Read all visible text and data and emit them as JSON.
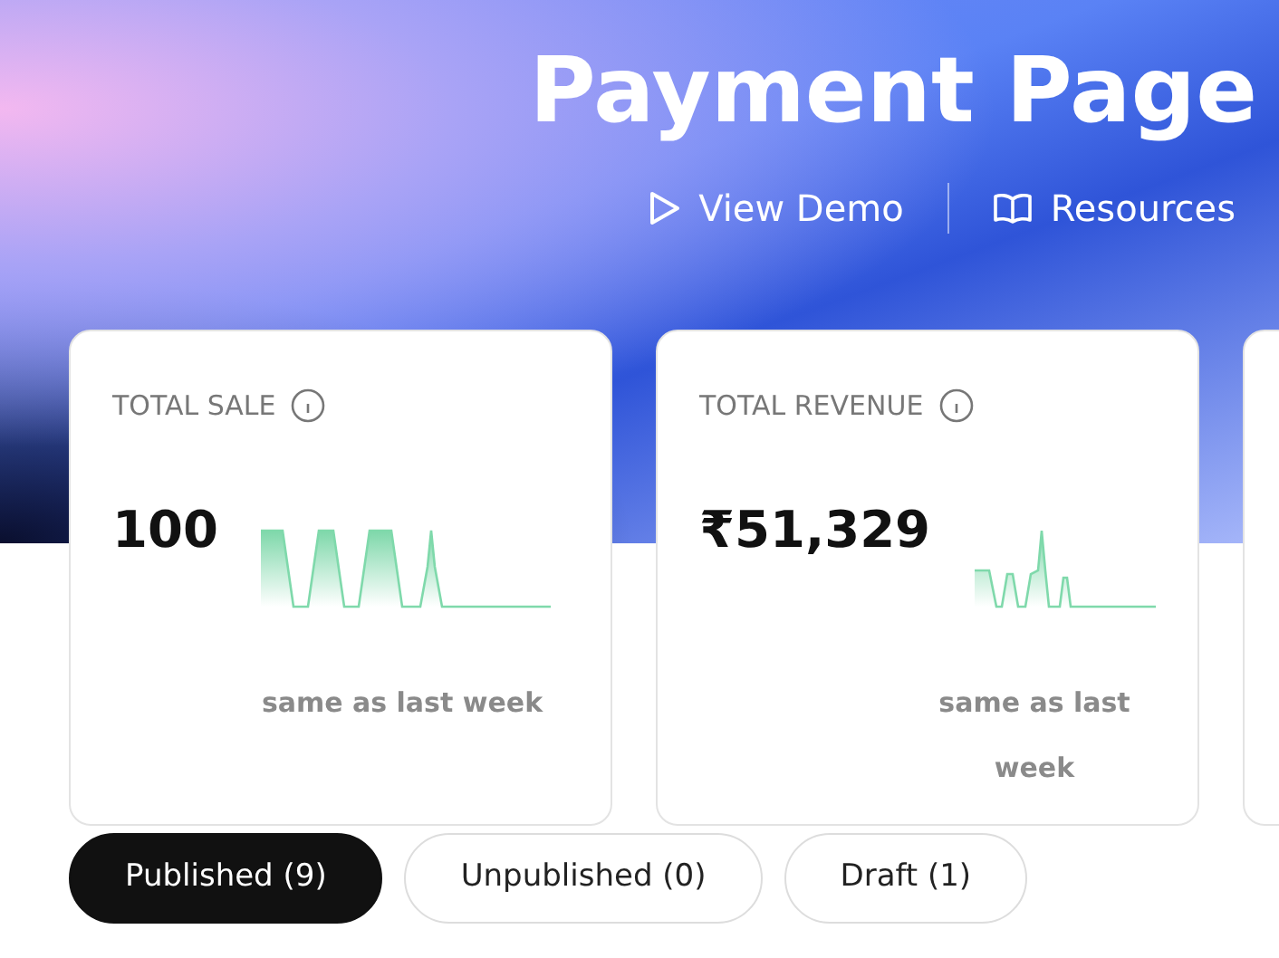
{
  "header": {
    "title": "Payment Page",
    "links": [
      {
        "kind": "play",
        "label": "View Demo"
      },
      {
        "kind": "book",
        "label": "Resources"
      }
    ]
  },
  "stats": [
    {
      "label": "TOTAL SALE",
      "value": "100",
      "trend": "same as last week"
    },
    {
      "label": "TOTAL REVENUE",
      "value": "₹51,329",
      "trend": "same as last week"
    }
  ],
  "tabs": [
    {
      "label": "Published (9)",
      "selected": true
    },
    {
      "label": "Unpublished (0)",
      "selected": false
    },
    {
      "label": "Draft (1)",
      "selected": false
    }
  ]
}
